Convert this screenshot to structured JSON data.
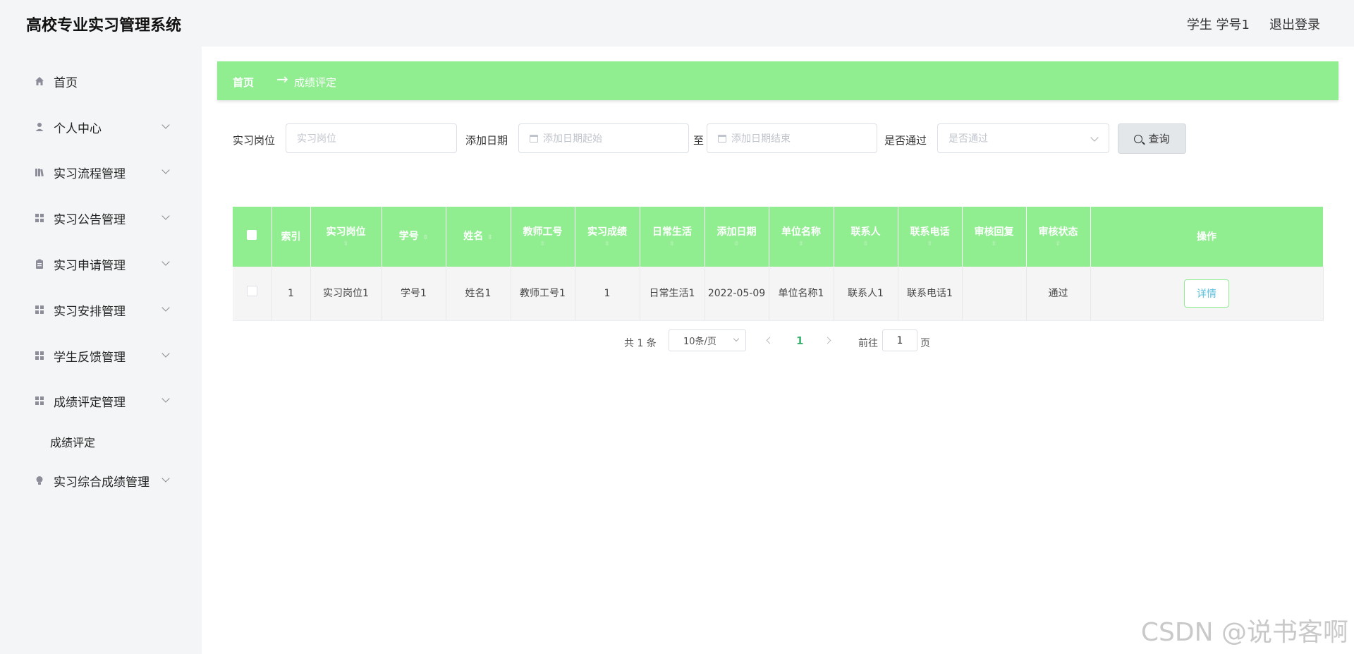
{
  "header": {
    "title": "高校专业实习管理系统",
    "user": "学生 学号1",
    "logout": "退出登录"
  },
  "sidebar": {
    "items": [
      {
        "label": "首页",
        "icon": "home-icon",
        "has_children": false
      },
      {
        "label": "个人中心",
        "icon": "user-icon",
        "has_children": true
      },
      {
        "label": "实习流程管理",
        "icon": "book-icon",
        "has_children": true
      },
      {
        "label": "实习公告管理",
        "icon": "grid-icon",
        "has_children": true
      },
      {
        "label": "实习申请管理",
        "icon": "clipboard-icon",
        "has_children": true
      },
      {
        "label": "实习安排管理",
        "icon": "grid-icon",
        "has_children": true
      },
      {
        "label": "学生反馈管理",
        "icon": "grid-icon",
        "has_children": true
      },
      {
        "label": "成绩评定管理",
        "icon": "grid-icon",
        "has_children": true
      },
      {
        "label": "实习综合成绩管理",
        "icon": "bulb-icon",
        "has_children": true
      }
    ],
    "sub_item": "成绩评定"
  },
  "breadcrumb": {
    "home": "首页",
    "arrow": "→",
    "current": "成绩评定"
  },
  "search": {
    "post_label": "实习岗位",
    "post_placeholder": "实习岗位",
    "date_label": "添加日期",
    "date_start_placeholder": "添加日期起始",
    "date_to": "至",
    "date_end_placeholder": "添加日期结束",
    "pass_label": "是否通过",
    "pass_placeholder": "是否通过",
    "query_button": "查询"
  },
  "table": {
    "columns": [
      "索引",
      "实习岗位",
      "学号",
      "姓名",
      "教师工号",
      "实习成绩",
      "日常生活",
      "添加日期",
      "单位名称",
      "联系人",
      "联系电话",
      "审核回复",
      "审核状态",
      "操作"
    ],
    "rows": [
      {
        "index": "1",
        "post": "实习岗位1",
        "student_id": "学号1",
        "name": "姓名1",
        "teacher_id": "教师工号1",
        "score": "1",
        "daily": "日常生活1",
        "date": "2022-05-09",
        "company": "单位名称1",
        "contact": "联系人1",
        "phone": "联系电话1",
        "reply": "",
        "status": "通过",
        "action": "详情"
      }
    ]
  },
  "pagination": {
    "total": "共 1 条",
    "page_size": "10条/页",
    "current_page": "1",
    "goto_label": "前往",
    "goto_value": "1",
    "page_suffix": "页"
  },
  "watermark": "CSDN @说书客啊",
  "colors": {
    "accent_green": "#90ee90",
    "page_number": "#3cb371",
    "link_blue": "#5bc0de"
  }
}
